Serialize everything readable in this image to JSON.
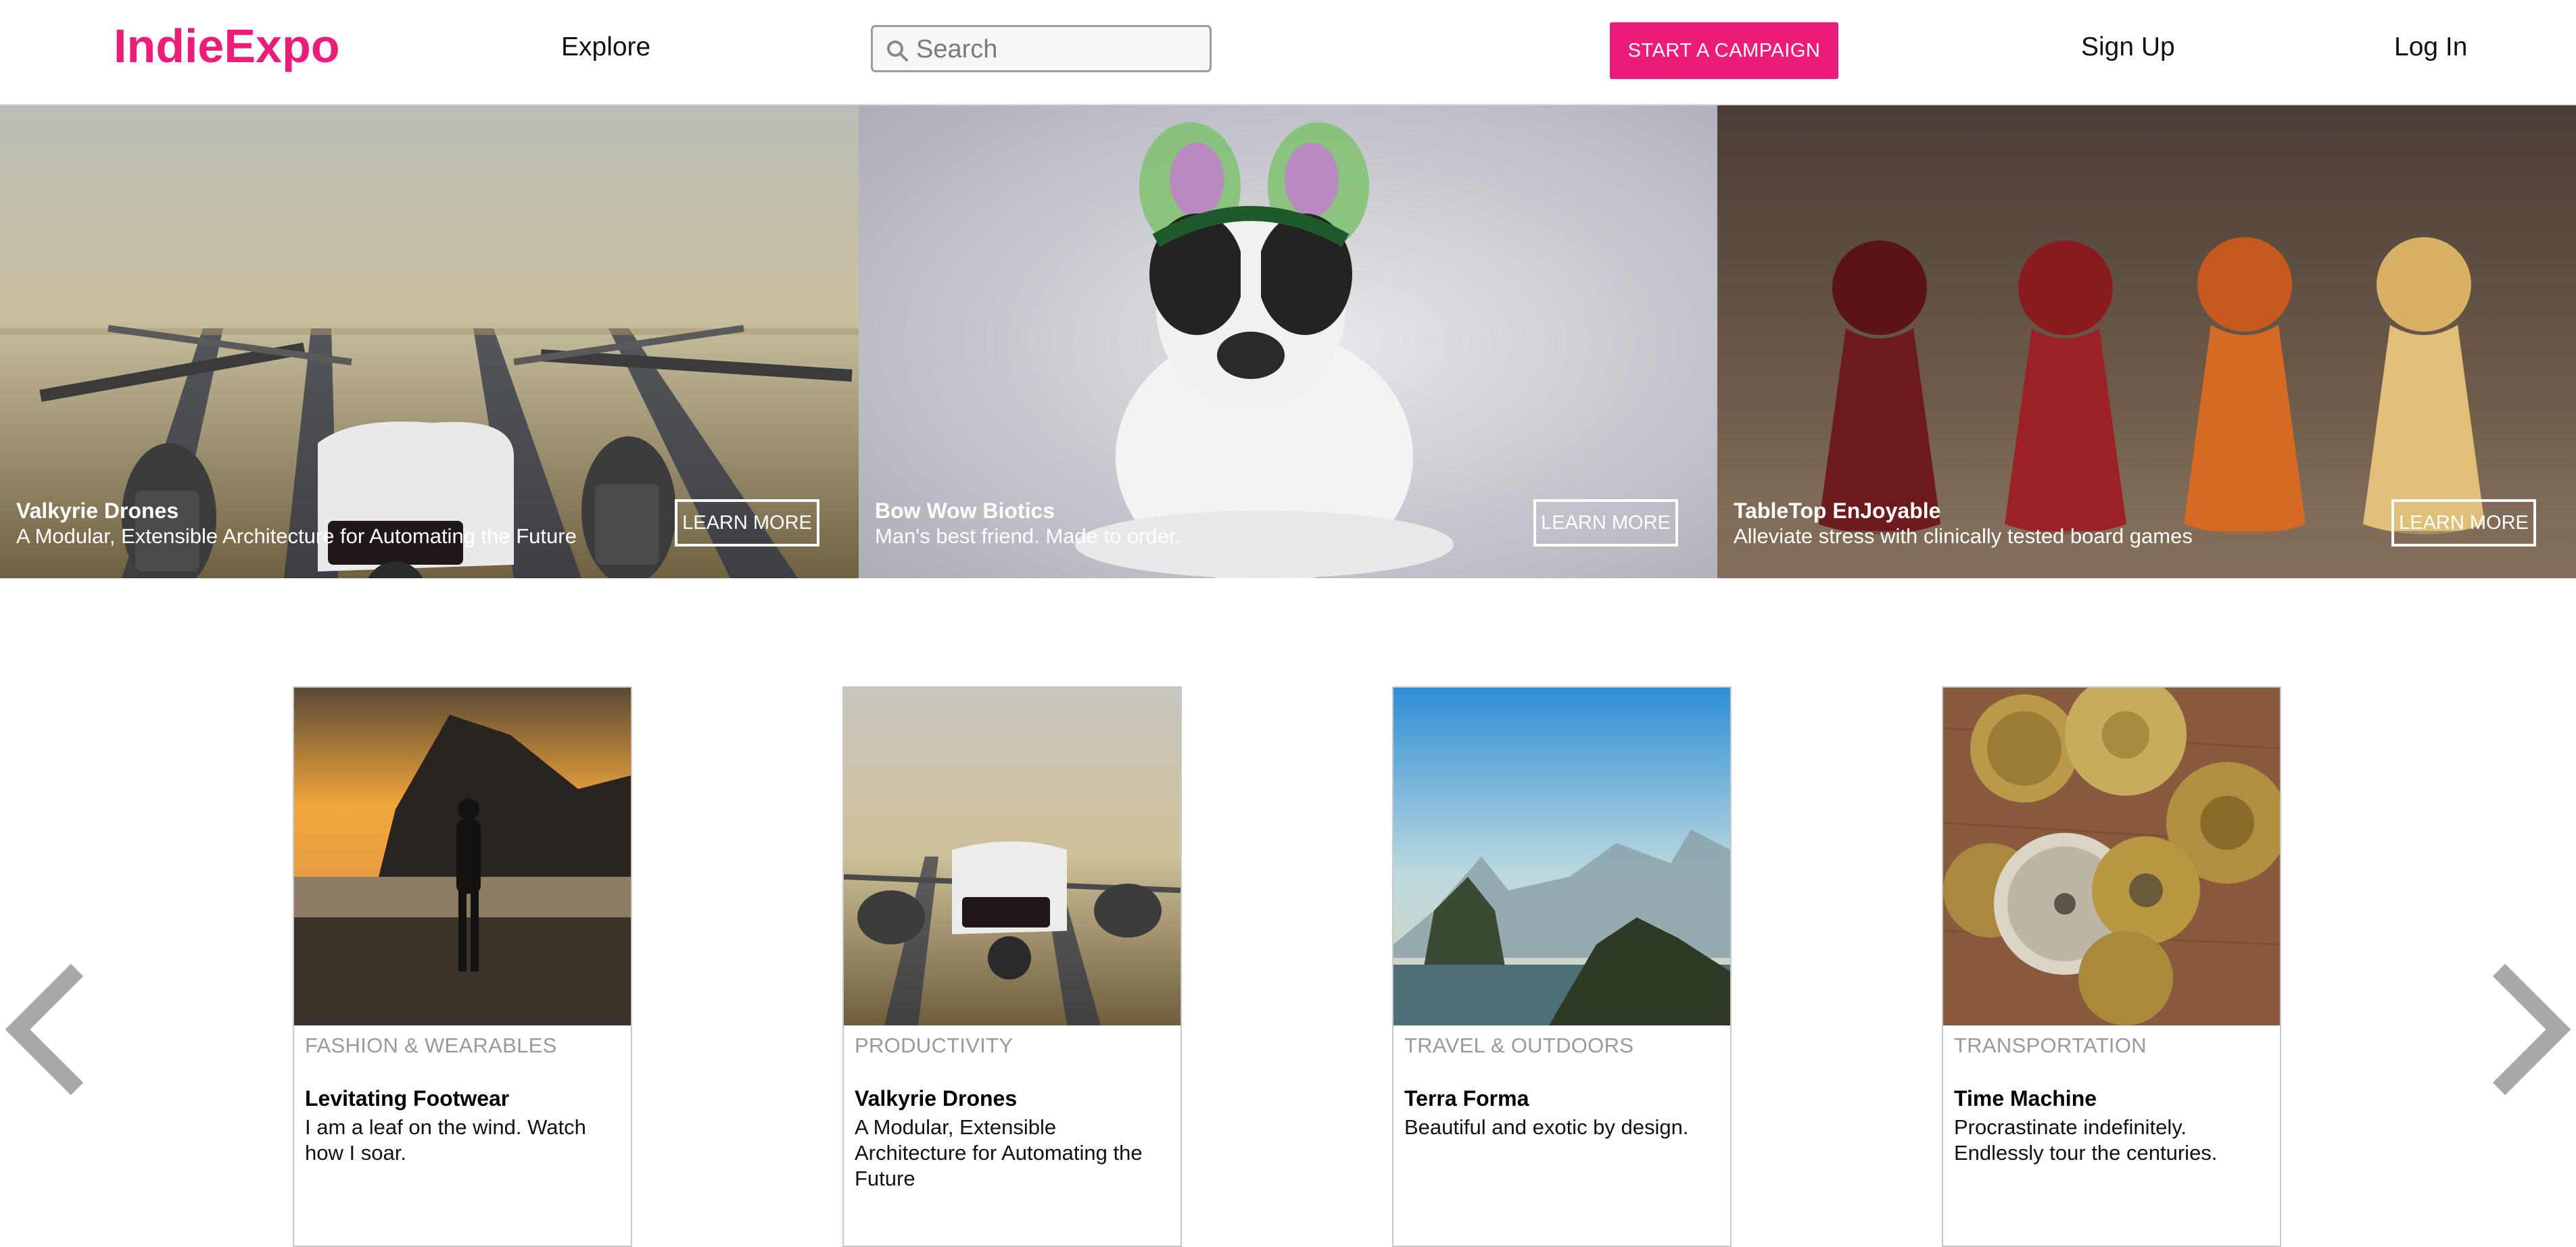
{
  "header": {
    "logo": "IndieExpo",
    "explore": "Explore",
    "search_placeholder": "Search",
    "cta": "START A CAMPAIGN",
    "signup": "Sign Up",
    "login": "Log In"
  },
  "hero": {
    "slides": [
      {
        "title": "Valkyrie Drones",
        "subtitle": "A Modular, Extensible Architecture for Automating the Future",
        "button": "LEARN MORE"
      },
      {
        "title": "Bow Wow Biotics",
        "subtitle": "Man's best friend. Made to order.",
        "button": "LEARN MORE"
      },
      {
        "title": "TableTop EnJoyable",
        "subtitle": "Alleviate stress with clinically tested board games",
        "button": "LEARN MORE"
      }
    ]
  },
  "cards": [
    {
      "category": "FASHION & WEARABLES",
      "title": "Levitating Footwear",
      "description": "I am a leaf on the wind. Watch how I soar."
    },
    {
      "category": "PRODUCTIVITY",
      "title": "Valkyrie Drones",
      "description": "A Modular, Extensible Architecture for Automating the Future"
    },
    {
      "category": "TRAVEL & OUTDOORS",
      "title": "Terra Forma",
      "description": "Beautiful and exotic by design."
    },
    {
      "category": "TRANSPORTATION",
      "title": "Time Machine",
      "description": "Procrastinate indefinitely. Endlessly tour the centuries."
    }
  ],
  "colors": {
    "brand": "#ec1c7a",
    "arrow": "#a8a8a8"
  },
  "icons": {
    "search": "search-icon",
    "prev": "chevron-left-icon",
    "next": "chevron-right-icon"
  }
}
